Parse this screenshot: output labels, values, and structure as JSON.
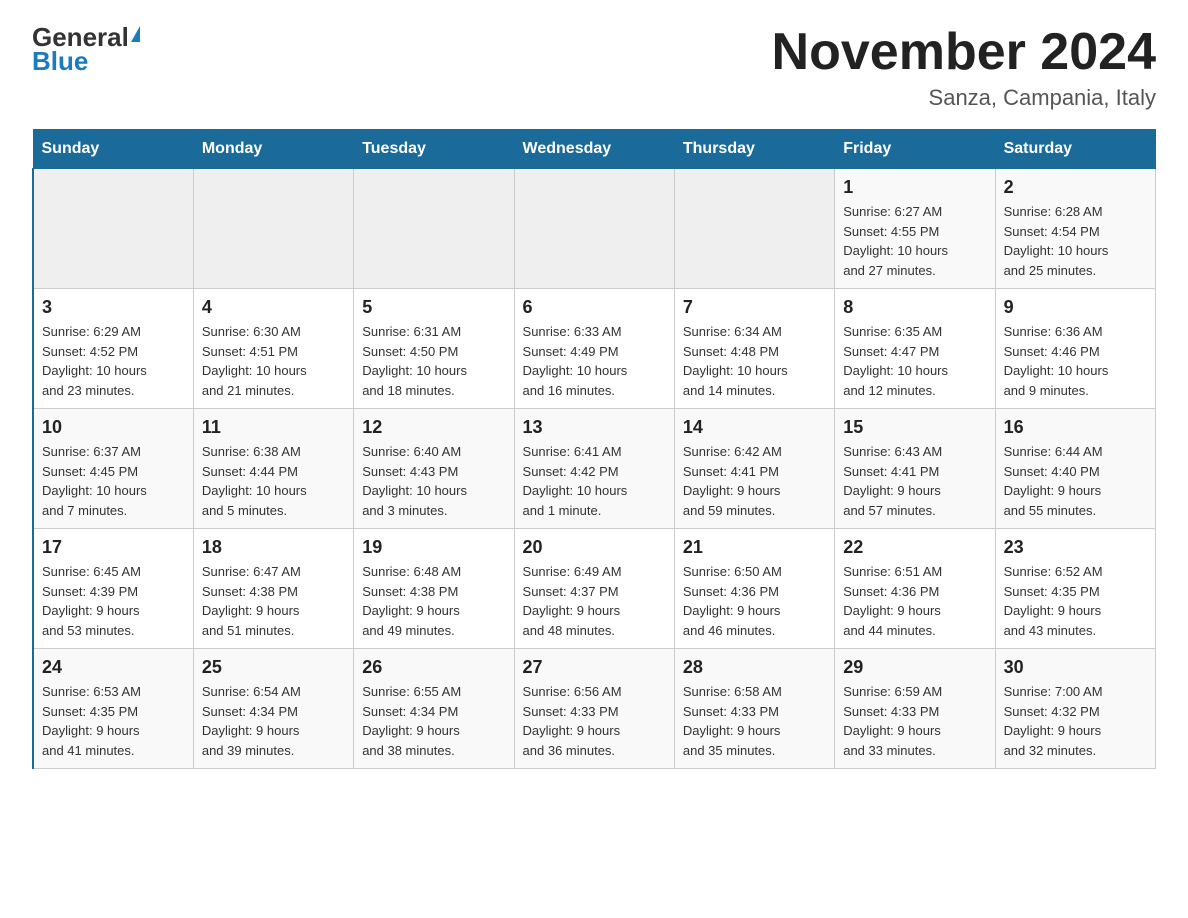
{
  "header": {
    "logo_general": "General",
    "logo_blue": "Blue",
    "month_title": "November 2024",
    "location": "Sanza, Campania, Italy"
  },
  "days_of_week": [
    "Sunday",
    "Monday",
    "Tuesday",
    "Wednesday",
    "Thursday",
    "Friday",
    "Saturday"
  ],
  "weeks": [
    [
      {
        "day": "",
        "info": ""
      },
      {
        "day": "",
        "info": ""
      },
      {
        "day": "",
        "info": ""
      },
      {
        "day": "",
        "info": ""
      },
      {
        "day": "",
        "info": ""
      },
      {
        "day": "1",
        "info": "Sunrise: 6:27 AM\nSunset: 4:55 PM\nDaylight: 10 hours\nand 27 minutes."
      },
      {
        "day": "2",
        "info": "Sunrise: 6:28 AM\nSunset: 4:54 PM\nDaylight: 10 hours\nand 25 minutes."
      }
    ],
    [
      {
        "day": "3",
        "info": "Sunrise: 6:29 AM\nSunset: 4:52 PM\nDaylight: 10 hours\nand 23 minutes."
      },
      {
        "day": "4",
        "info": "Sunrise: 6:30 AM\nSunset: 4:51 PM\nDaylight: 10 hours\nand 21 minutes."
      },
      {
        "day": "5",
        "info": "Sunrise: 6:31 AM\nSunset: 4:50 PM\nDaylight: 10 hours\nand 18 minutes."
      },
      {
        "day": "6",
        "info": "Sunrise: 6:33 AM\nSunset: 4:49 PM\nDaylight: 10 hours\nand 16 minutes."
      },
      {
        "day": "7",
        "info": "Sunrise: 6:34 AM\nSunset: 4:48 PM\nDaylight: 10 hours\nand 14 minutes."
      },
      {
        "day": "8",
        "info": "Sunrise: 6:35 AM\nSunset: 4:47 PM\nDaylight: 10 hours\nand 12 minutes."
      },
      {
        "day": "9",
        "info": "Sunrise: 6:36 AM\nSunset: 4:46 PM\nDaylight: 10 hours\nand 9 minutes."
      }
    ],
    [
      {
        "day": "10",
        "info": "Sunrise: 6:37 AM\nSunset: 4:45 PM\nDaylight: 10 hours\nand 7 minutes."
      },
      {
        "day": "11",
        "info": "Sunrise: 6:38 AM\nSunset: 4:44 PM\nDaylight: 10 hours\nand 5 minutes."
      },
      {
        "day": "12",
        "info": "Sunrise: 6:40 AM\nSunset: 4:43 PM\nDaylight: 10 hours\nand 3 minutes."
      },
      {
        "day": "13",
        "info": "Sunrise: 6:41 AM\nSunset: 4:42 PM\nDaylight: 10 hours\nand 1 minute."
      },
      {
        "day": "14",
        "info": "Sunrise: 6:42 AM\nSunset: 4:41 PM\nDaylight: 9 hours\nand 59 minutes."
      },
      {
        "day": "15",
        "info": "Sunrise: 6:43 AM\nSunset: 4:41 PM\nDaylight: 9 hours\nand 57 minutes."
      },
      {
        "day": "16",
        "info": "Sunrise: 6:44 AM\nSunset: 4:40 PM\nDaylight: 9 hours\nand 55 minutes."
      }
    ],
    [
      {
        "day": "17",
        "info": "Sunrise: 6:45 AM\nSunset: 4:39 PM\nDaylight: 9 hours\nand 53 minutes."
      },
      {
        "day": "18",
        "info": "Sunrise: 6:47 AM\nSunset: 4:38 PM\nDaylight: 9 hours\nand 51 minutes."
      },
      {
        "day": "19",
        "info": "Sunrise: 6:48 AM\nSunset: 4:38 PM\nDaylight: 9 hours\nand 49 minutes."
      },
      {
        "day": "20",
        "info": "Sunrise: 6:49 AM\nSunset: 4:37 PM\nDaylight: 9 hours\nand 48 minutes."
      },
      {
        "day": "21",
        "info": "Sunrise: 6:50 AM\nSunset: 4:36 PM\nDaylight: 9 hours\nand 46 minutes."
      },
      {
        "day": "22",
        "info": "Sunrise: 6:51 AM\nSunset: 4:36 PM\nDaylight: 9 hours\nand 44 minutes."
      },
      {
        "day": "23",
        "info": "Sunrise: 6:52 AM\nSunset: 4:35 PM\nDaylight: 9 hours\nand 43 minutes."
      }
    ],
    [
      {
        "day": "24",
        "info": "Sunrise: 6:53 AM\nSunset: 4:35 PM\nDaylight: 9 hours\nand 41 minutes."
      },
      {
        "day": "25",
        "info": "Sunrise: 6:54 AM\nSunset: 4:34 PM\nDaylight: 9 hours\nand 39 minutes."
      },
      {
        "day": "26",
        "info": "Sunrise: 6:55 AM\nSunset: 4:34 PM\nDaylight: 9 hours\nand 38 minutes."
      },
      {
        "day": "27",
        "info": "Sunrise: 6:56 AM\nSunset: 4:33 PM\nDaylight: 9 hours\nand 36 minutes."
      },
      {
        "day": "28",
        "info": "Sunrise: 6:58 AM\nSunset: 4:33 PM\nDaylight: 9 hours\nand 35 minutes."
      },
      {
        "day": "29",
        "info": "Sunrise: 6:59 AM\nSunset: 4:33 PM\nDaylight: 9 hours\nand 33 minutes."
      },
      {
        "day": "30",
        "info": "Sunrise: 7:00 AM\nSunset: 4:32 PM\nDaylight: 9 hours\nand 32 minutes."
      }
    ]
  ]
}
